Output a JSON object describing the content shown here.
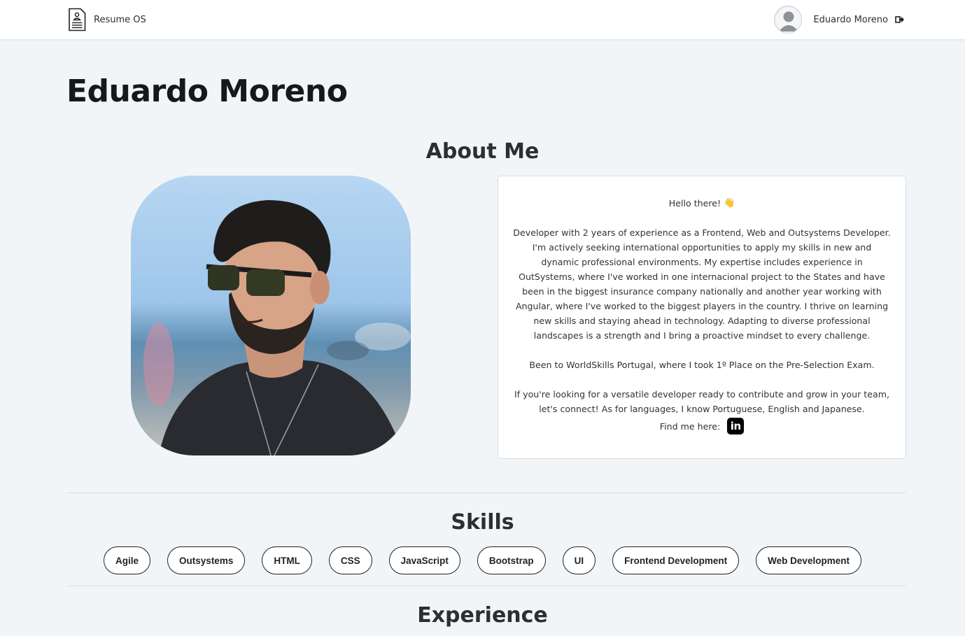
{
  "header": {
    "brand_name": "Resume OS",
    "user_name": "Eduardo Moreno",
    "brand_icon": "resume-document-icon",
    "logout_icon": "logout-icon"
  },
  "profile": {
    "name": "Eduardo Moreno"
  },
  "about": {
    "title": "About Me",
    "greeting": "Hello there!",
    "greeting_emoji": "👋",
    "paragraph1": "Developer with 2 years of experience as a Frontend, Web and Outsystems Developer. I'm actively seeking international opportunities to apply my skills in new and dynamic professional environments. My expertise includes experience in OutSystems, where I've worked in one internacional project to the States and have been in the biggest insurance company nationally and another year working with Angular, where I've worked to the biggest players in the country. I thrive on learning new skills and staying ahead in technology. Adapting to diverse professional landscapes is a strength and I bring a proactive mindset to every challenge.",
    "paragraph2": "Been to WorldSkills Portugal, where I took 1º Place on the Pre-Selection Exam.",
    "paragraph3": "If you're looking for a versatile developer ready to contribute and grow in your team, let's connect! As for languages, I know Portuguese, English and Japanese.",
    "find_me": "Find me here:",
    "linkedin_label": "in"
  },
  "skills": {
    "title": "Skills",
    "items": [
      "Agile",
      "Outsystems",
      "HTML",
      "CSS",
      "JavaScript",
      "Bootstrap",
      "UI",
      "Frontend Development",
      "Web Development"
    ]
  },
  "experience": {
    "title": "Experience"
  },
  "colors": {
    "page_background": "#f2f5f8",
    "card_background": "#ffffff",
    "text_dark": "#1f2328",
    "pill_border": "#1e2226"
  }
}
